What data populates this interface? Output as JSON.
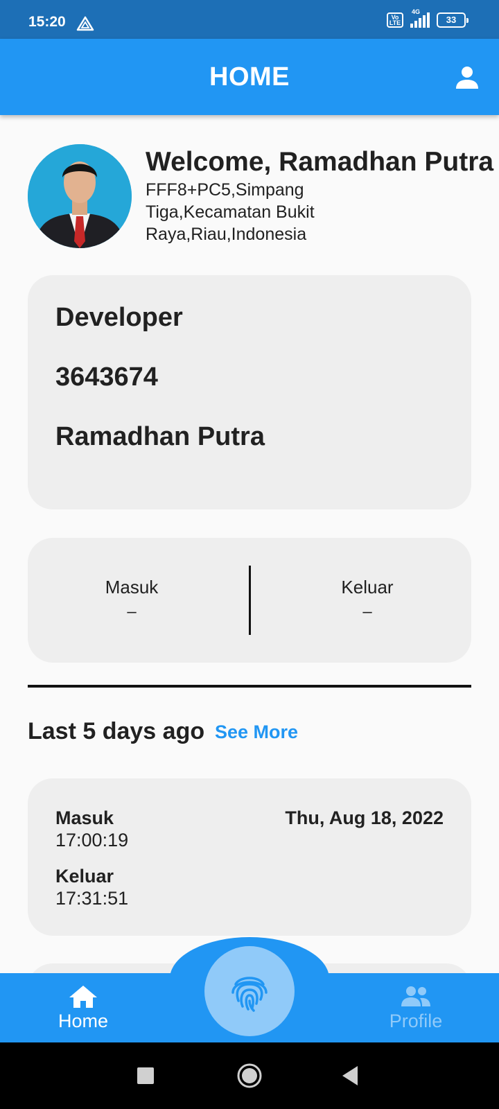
{
  "status_bar": {
    "time": "15:20",
    "volte": "Vo LTE",
    "network": "4G",
    "battery": "33"
  },
  "app_bar": {
    "title": "HOME"
  },
  "user": {
    "welcome": "Welcome, Ramadhan Putra",
    "address": "FFF8+PC5,Simpang Tiga,Kecamatan Bukit Raya,Riau,Indonesia"
  },
  "info_card": {
    "role": "Developer",
    "id": "3643674",
    "name": "Ramadhan Putra"
  },
  "attendance_today": {
    "in_label": "Masuk",
    "in_value": "–",
    "out_label": "Keluar",
    "out_value": "–"
  },
  "history": {
    "title": "Last 5 days ago",
    "see_more": "See More",
    "items": [
      {
        "in_label": "Masuk",
        "in_time": "17:00:19",
        "out_label": "Keluar",
        "out_time": "17:31:51",
        "date": "Thu, Aug 18, 2022"
      }
    ]
  },
  "bottom_nav": {
    "home_label": "Home",
    "profile_label": "Profile"
  },
  "colors": {
    "primary": "#2196f3",
    "status_bar": "#1d6fb6",
    "card": "#eeeeee",
    "fab": "#90caf9"
  },
  "icons": [
    "alert-triangle-icon",
    "person-icon",
    "home-icon",
    "fingerprint-icon",
    "group-icon",
    "square-icon",
    "circle-icon",
    "back-triangle-icon"
  ]
}
